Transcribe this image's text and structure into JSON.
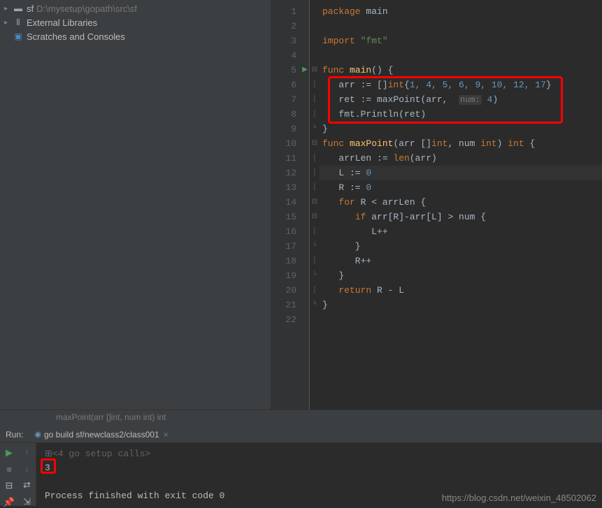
{
  "sidebar": {
    "items": [
      {
        "label": "sf",
        "path": "D:\\mysetup\\gopath\\src\\sf",
        "icon": "folder"
      },
      {
        "label": "External Libraries",
        "icon": "lib"
      },
      {
        "label": "Scratches and Consoles",
        "icon": "scratch"
      }
    ]
  },
  "editor": {
    "lines": [
      {
        "n": 1
      },
      {
        "n": 2
      },
      {
        "n": 3
      },
      {
        "n": 4
      },
      {
        "n": 5,
        "run": true
      },
      {
        "n": 6
      },
      {
        "n": 7
      },
      {
        "n": 8
      },
      {
        "n": 9
      },
      {
        "n": 10
      },
      {
        "n": 11
      },
      {
        "n": 12,
        "current": true
      },
      {
        "n": 13
      },
      {
        "n": 14
      },
      {
        "n": 15
      },
      {
        "n": 16
      },
      {
        "n": 17
      },
      {
        "n": 18
      },
      {
        "n": 19
      },
      {
        "n": 20
      },
      {
        "n": 21
      },
      {
        "n": 22
      }
    ],
    "code": {
      "package_kw": "package",
      "package_name": " main",
      "import_kw": "import",
      "import_val": " \"fmt\"",
      "func_kw": "func",
      "main_name": " main",
      "main_sig": "() {",
      "arr_decl_pre": "   arr := []",
      "int_kw": "int",
      "arr_vals_open": "{",
      "arr_vals": "1, 4, 5, 6, 9, 10, 12, 17",
      "arr_vals_close": "}",
      "ret_pre": "   ret := ",
      "maxpoint_call": "maxPoint",
      "ret_args_open": "(arr,  ",
      "hint_num": "num:",
      "ret_args_val": " 4",
      "ret_args_close": ")",
      "println_pre": "   fmt.",
      "println_fn": "Println",
      "println_args": "(ret)",
      "close_brace": "}",
      "maxpoint_name": " maxPoint",
      "maxpoint_sig_pre": "(arr []",
      "maxpoint_sig_mid": ", num ",
      "maxpoint_sig_ret": ") ",
      "maxpoint_sig_end": " {",
      "arrlen_pre": "   arrLen := ",
      "len_fn": "len",
      "arrlen_args": "(arr)",
      "l_decl": "   L := ",
      "zero": "0",
      "r_decl": "   R := ",
      "for_kw": "for",
      "for_cond": " R < arrLen {",
      "if_kw": "if",
      "if_cond": " arr[R]-arr[L] > num {",
      "lpp": "         L++",
      "inner_close": "      }",
      "rpp": "      R++",
      "for_close": "   }",
      "return_kw": "return",
      "return_val": " R - L"
    },
    "breadcrumb": "maxPoint(arr []int, num int) int"
  },
  "run": {
    "label": "Run:",
    "tab": "go build sf/newclass2/class001",
    "console": {
      "setup": "<4 go setup calls>",
      "output": "3",
      "exit": "Process finished with exit code 0"
    }
  },
  "watermark": "https://blog.csdn.net/weixin_48502062"
}
